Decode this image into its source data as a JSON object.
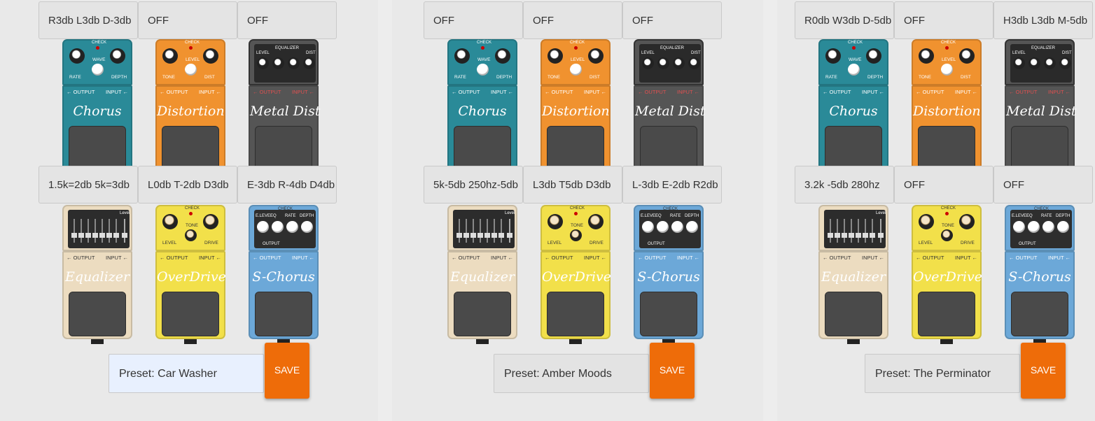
{
  "boards": [
    {
      "top_fields": [
        "R3db L3db D-3db",
        "OFF",
        "OFF"
      ],
      "bottom_fields": [
        "1.5k=2db 5k=3db",
        "L0db T-2db D3db",
        "E-3db R-4db D4db"
      ],
      "preset_label": "Preset: ",
      "preset_name": "Car Washer",
      "save_label": "SAVE"
    },
    {
      "top_fields": [
        "OFF",
        "OFF",
        "OFF"
      ],
      "bottom_fields": [
        "5k-5db 250hz-5db",
        "L3db T5db D3db",
        "L-3db E-2db R2db"
      ],
      "preset_label": "Preset: ",
      "preset_name": "Amber Moods",
      "save_label": "SAVE"
    },
    {
      "top_fields": [
        "R0db W3db D-5db",
        "OFF",
        "H3db L3db M-5db"
      ],
      "bottom_fields": [
        "3.2k -5db 280hz",
        "OFF",
        "OFF"
      ],
      "preset_label": "Preset: ",
      "preset_name": "The Perminator",
      "save_label": "SAVE"
    }
  ],
  "pedals": {
    "chorus": {
      "name": "Chorus",
      "k1": "RATE",
      "k2": "DEPTH",
      "mid": "WAVE",
      "check": "CHECK"
    },
    "distortion": {
      "name": "Distortion",
      "k1": "TONE",
      "k2": "DIST",
      "mid": "LEVEL",
      "check": "CHECK"
    },
    "metal": {
      "name": "Metal Dist",
      "k1": "LEVEL",
      "k2": "DIST",
      "mid": "EQUALIZER",
      "check": "CHECK"
    },
    "equalizer": {
      "name": "Equalizer",
      "level": "Level"
    },
    "overdrive": {
      "name": "OverDrive",
      "k1": "LEVEL",
      "k2": "DRIVE",
      "mid": "TONE",
      "check": "CHECK"
    },
    "schorus": {
      "name": "S-Chorus",
      "labels": [
        "E.LEVEL",
        "EQ",
        "RATE",
        "DEPTH"
      ],
      "out": "OUTPUT",
      "check": "CHECK"
    }
  },
  "jacks": {
    "output": "← OUTPUT",
    "input": "INPUT ←"
  },
  "colors": {
    "chorus": "#2a8a98",
    "distortion": "#f0922f",
    "metal": "#555555",
    "equalizer": "#ecdcc0",
    "overdrive": "#f2e04a",
    "schorus": "#6ca8d8",
    "save": "#ee6c09"
  }
}
